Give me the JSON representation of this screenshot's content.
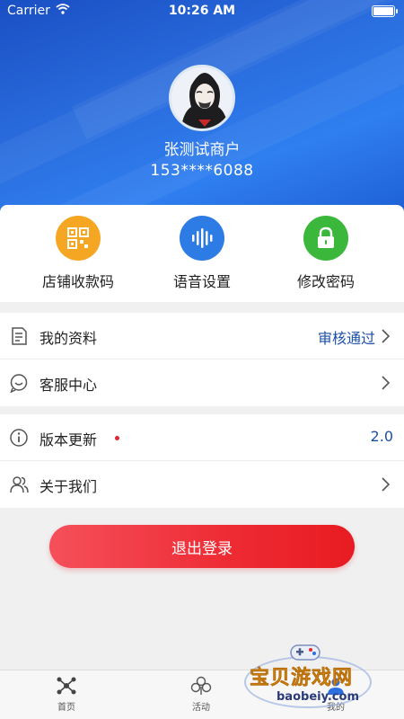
{
  "status_bar": {
    "carrier": "Carrier",
    "time": "10:26 AM"
  },
  "profile": {
    "name": "张测试商户",
    "phone": "153****6088"
  },
  "quick_actions": [
    {
      "label": "店铺收款码",
      "icon": "qr-code-icon",
      "color": "#f5a623"
    },
    {
      "label": "语音设置",
      "icon": "voice-wave-icon",
      "color": "#2d7be5"
    },
    {
      "label": "修改密码",
      "icon": "lock-icon",
      "color": "#3bb83b"
    }
  ],
  "menu_group_1": [
    {
      "label": "我的资料",
      "value": "审核通过",
      "icon": "document-icon"
    },
    {
      "label": "客服中心",
      "value": "",
      "icon": "chat-bubble-icon"
    }
  ],
  "menu_group_2": [
    {
      "label": "版本更新",
      "value": "2.0",
      "icon": "info-icon",
      "badge": "red-dot"
    },
    {
      "label": "关于我们",
      "value": "",
      "icon": "people-icon"
    }
  ],
  "logout_label": "退出登录",
  "tabs": [
    {
      "label": "首页",
      "icon": "molecule-icon"
    },
    {
      "label": "活动",
      "icon": "clover-icon"
    },
    {
      "label": "我的",
      "icon": "user-icon"
    }
  ],
  "watermark": {
    "title": "宝贝游戏网",
    "sub": "baobeiy.com"
  },
  "colors": {
    "header_blue": "#2b6fe0",
    "accent_red": "#ee2a33",
    "link_blue": "#1c4fa8"
  }
}
